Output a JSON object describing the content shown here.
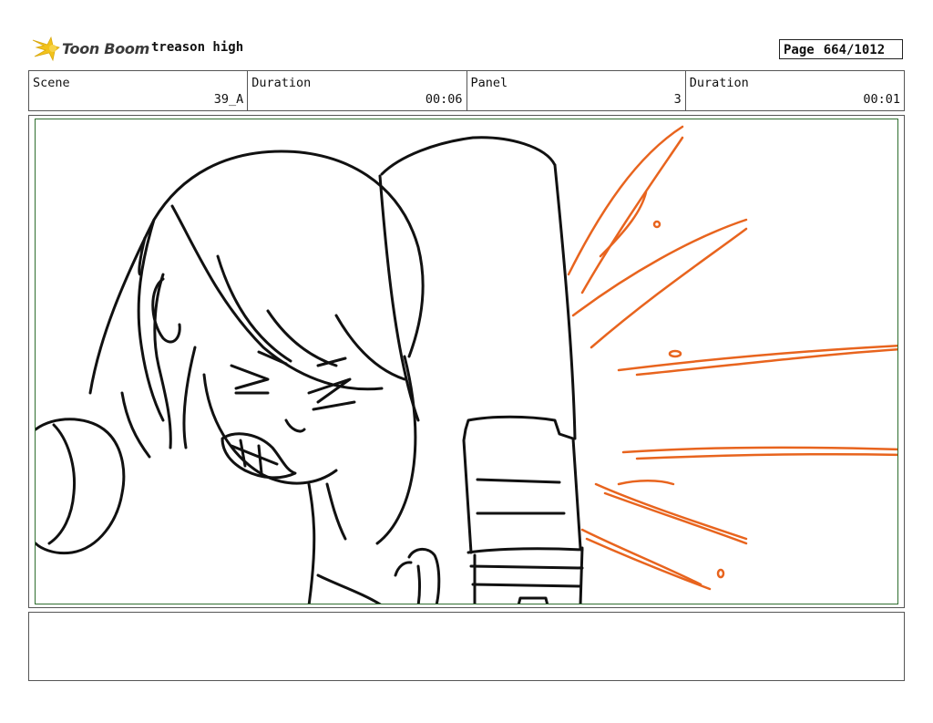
{
  "header": {
    "logo_text": "Toon Boom",
    "project_title": "treason high",
    "page_label": "Page",
    "page_number": "664/1012"
  },
  "info": {
    "scene_label": "Scene",
    "scene_value": "39_A",
    "duration_label": "Duration",
    "duration_value": "00:06",
    "panel_label": "Panel",
    "panel_value": "3",
    "panel_duration_label": "Duration",
    "panel_duration_value": "00:01"
  },
  "colors": {
    "frame_green": "#2f6e2f",
    "impact_orange": "#e8641e",
    "line_black": "#111111",
    "logo_yellow": "#f2c21b"
  },
  "notes": {
    "text": ""
  }
}
